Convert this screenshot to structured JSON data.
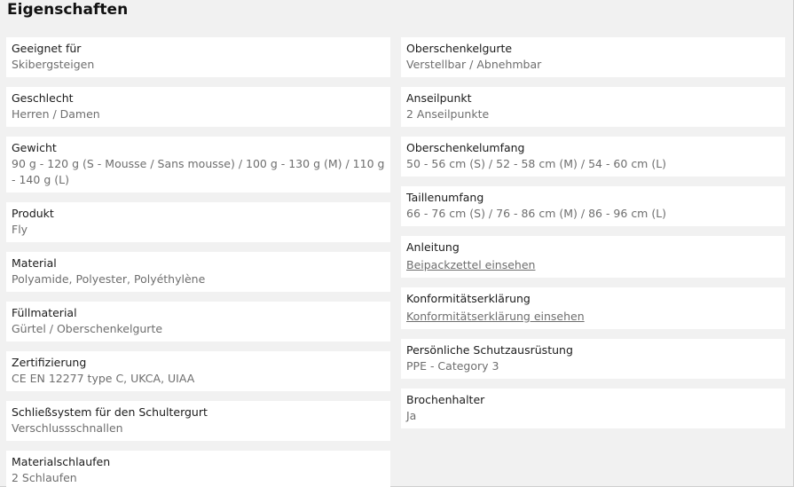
{
  "section_title": "Eigenschaften",
  "left": [
    {
      "label": "Geeignet für",
      "value": "Skibergsteigen"
    },
    {
      "label": "Geschlecht",
      "value": "Herren / Damen"
    },
    {
      "label": "Gewicht",
      "value": "90 g - 120 g (S - Mousse / Sans mousse) / 100 g - 130 g (M) / 110 g - 140 g (L)"
    },
    {
      "label": "Produkt",
      "value": "Fly"
    },
    {
      "label": "Material",
      "value": "Polyamide, Polyester, Polyéthylène"
    },
    {
      "label": "Füllmaterial",
      "value": "Gürtel / Oberschenkelgurte"
    },
    {
      "label": "Zertifizierung",
      "value": "CE EN 12277 type C, UKCA, UIAA"
    },
    {
      "label": "Schließsystem für den Schultergurt",
      "value": "Verschlussschnallen"
    },
    {
      "label": "Materialschlaufen",
      "value": "2 Schlaufen"
    }
  ],
  "right": [
    {
      "label": "Oberschenkelgurte",
      "value": "Verstellbar / Abnehmbar"
    },
    {
      "label": "Anseilpunkt",
      "value": "2 Anseilpunkte"
    },
    {
      "label": "Oberschenkelumfang",
      "value": "50 - 56 cm (S) / 52 - 58 cm (M) / 54 - 60 cm (L)"
    },
    {
      "label": "Taillenumfang",
      "value": "66 - 76 cm (S) / 76 - 86 cm (M) / 86 - 96 cm (L)"
    },
    {
      "label": "Anleitung",
      "value": "Beipackzettel einsehen"
    },
    {
      "label": "Konformitätserklärung",
      "value": "Konformitätserklärung einsehen"
    },
    {
      "label": "Persönliche Schutzausrüstung",
      "value": "PPE - Category 3"
    },
    {
      "label": "Brochenhalter",
      "value": "Ja"
    }
  ]
}
